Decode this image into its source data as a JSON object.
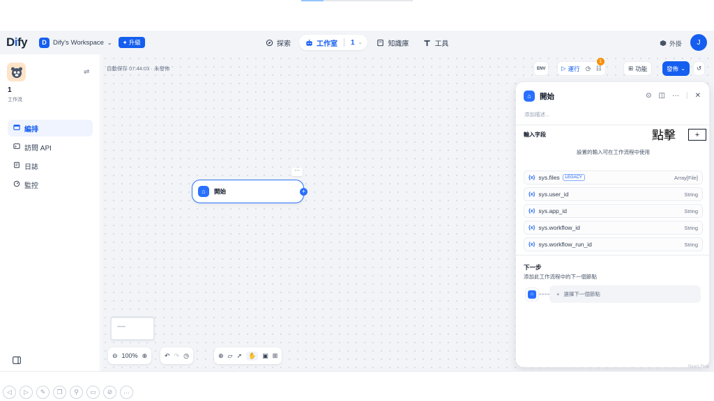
{
  "header": {
    "logo": "Dify",
    "workspace_initial": "D",
    "workspace_name": "Dify's Workspace",
    "upgrade_label": "升級",
    "nav": {
      "explore": "探索",
      "studio": "工作室",
      "studio_count": "1",
      "knowledge": "知識庫",
      "tools": "工具"
    },
    "plugins_label": "外掛",
    "avatar_initial": "J"
  },
  "sidebar": {
    "app_name": "1",
    "app_type": "工作流",
    "items": [
      {
        "label": "編排",
        "icon": "orchestrate-icon",
        "active": true
      },
      {
        "label": "訪問 API",
        "icon": "terminal-icon",
        "active": false
      },
      {
        "label": "日誌",
        "icon": "log-icon",
        "active": false
      },
      {
        "label": "監控",
        "icon": "monitor-icon",
        "active": false
      }
    ]
  },
  "canvas": {
    "autosave": "自動保存 07:44:03 · 未發佈",
    "node_title": "開始",
    "zoom": "100%"
  },
  "toolbar": {
    "env_label": "ENV",
    "run_label": "運行",
    "checklist_count": "1",
    "features_label": "功能",
    "publish_label": "發佈"
  },
  "panel": {
    "title": "開始",
    "description_placeholder": "添加描述...",
    "inputs_label": "輸入字段",
    "click_annotation": "點擊",
    "inputs_hint": "設置的輸入可在工作流程中使用",
    "variables": [
      {
        "name": "sys.files",
        "badge": "LEGACY",
        "type": "Array[File]"
      },
      {
        "name": "sys.user_id",
        "badge": "",
        "type": "String"
      },
      {
        "name": "sys.app_id",
        "badge": "",
        "type": "String"
      },
      {
        "name": "sys.workflow_id",
        "badge": "",
        "type": "String"
      },
      {
        "name": "sys.workflow_run_id",
        "badge": "",
        "type": "String"
      }
    ],
    "next_step_title": "下一步",
    "next_step_desc": "添加此工作流程中的下一個節點",
    "next_select_placeholder": "選擇下一個節點"
  },
  "colors": {
    "accent": "#155eef",
    "node_border": "#2970ff",
    "warning": "#f79009"
  }
}
